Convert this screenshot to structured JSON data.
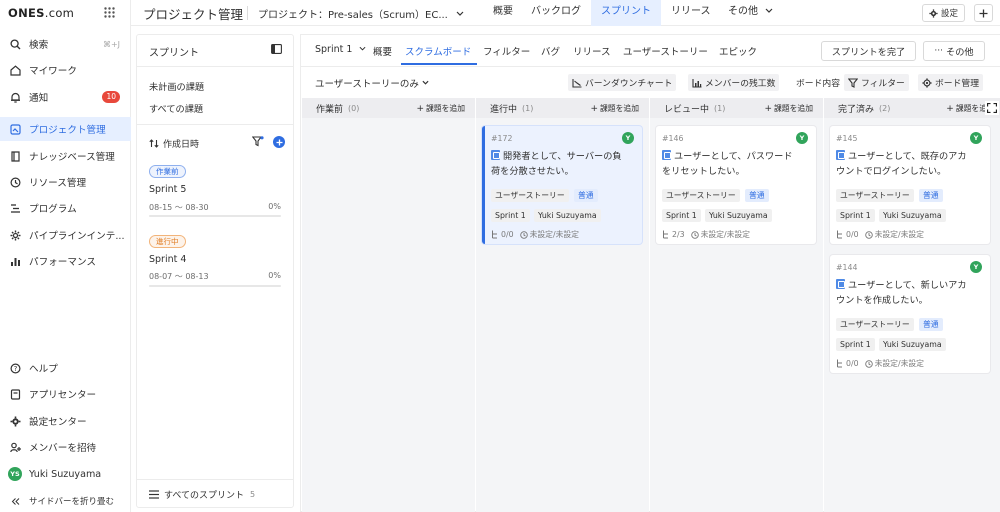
{
  "logo": {
    "text": "ONES",
    "suffix": ".com"
  },
  "nav": {
    "search": {
      "label": "検索",
      "shortcut": "⌘+J"
    },
    "mywork": "マイワーク",
    "notify": {
      "label": "通知",
      "count": "10"
    },
    "project": "プロジェクト管理",
    "wiki": "ナレッジベース管理",
    "resource": "リソース管理",
    "program": "プログラム",
    "pipeline": "パイプラインインテ...",
    "performance": "パフォーマンス",
    "help": "ヘルプ",
    "appcenter": "アプリセンター",
    "settings": "設定センター",
    "invite": "メンバーを招待",
    "user": {
      "name": "Yuki Suzuyama",
      "initials": "YS"
    },
    "collapse": "サイドバーを折り畳む"
  },
  "topbar": {
    "title": "プロジェクト管理",
    "project": "プロジェクト：Pre-sales（Scrum）EC...",
    "tabs": [
      "概要",
      "バックログ",
      "スプリント",
      "リリース",
      "その他"
    ],
    "settings": "設定"
  },
  "sprint_panel": {
    "title": "スプリント",
    "links": [
      "未計画の課題",
      "すべての課題"
    ],
    "sort": "作成日時",
    "sprints": [
      {
        "status": "作業前",
        "name": "Sprint 5",
        "dates": "08-15 〜 08-30",
        "percent": "0%",
        "progress": 0
      },
      {
        "status": "進行中",
        "name": "Sprint 4",
        "dates": "08-07 〜 08-13",
        "percent": "0%",
        "progress": 0
      }
    ],
    "footer": {
      "label": "すべてのスプリント",
      "count": "5"
    }
  },
  "board": {
    "sprint_select": "Sprint 1",
    "tabs": [
      "概要",
      "スクラムボード",
      "フィルター",
      "バグ",
      "リリース",
      "ユーザーストーリー",
      "エピック"
    ],
    "complete_button": "スプリントを完了",
    "more_button": "その他",
    "filter_select": "ユーザーストーリーのみ",
    "tools": {
      "burndown": "バーンダウンチャート",
      "remaining": "メンバーの残工数",
      "content": "ボード内容",
      "filter": "フィルター",
      "manage": "ボード管理"
    },
    "add_label": "課題を追加",
    "add_label_last": "課題を追",
    "columns": [
      {
        "name": "作業前",
        "count": "(0)",
        "cards": []
      },
      {
        "name": "進行中",
        "count": "(1)",
        "cards": [
          {
            "key": "#172",
            "line1": "開発者として、サーバーの負",
            "line2": "荷を分散させたい。",
            "type": "ユーザーストーリー",
            "priority": "普通",
            "sprint": "Sprint 1",
            "assignee": "Yuki Suzuyama",
            "subtasks": "0/0",
            "time": "未設定/未設定",
            "avatar": "Y"
          }
        ]
      },
      {
        "name": "レビュー中",
        "count": "(1)",
        "cards": [
          {
            "key": "#146",
            "line1": "ユーザーとして、パスワード",
            "line2": "をリセットしたい。",
            "type": "ユーザーストーリー",
            "priority": "普通",
            "sprint": "Sprint 1",
            "assignee": "Yuki Suzuyama",
            "subtasks": "2/3",
            "time": "未設定/未設定",
            "avatar": "Y"
          }
        ]
      },
      {
        "name": "完了済み",
        "count": "(2)",
        "cards": [
          {
            "key": "#145",
            "line1": "ユーザーとして、既存のアカ",
            "line2": "ウントでログインしたい。",
            "type": "ユーザーストーリー",
            "priority": "普通",
            "sprint": "Sprint 1",
            "assignee": "Yuki Suzuyama",
            "subtasks": "0/0",
            "time": "未設定/未設定",
            "avatar": "Y"
          },
          {
            "key": "#144",
            "line1": "ユーザーとして、新しいアカ",
            "line2": "ウントを作成したい。",
            "type": "ユーザーストーリー",
            "priority": "普通",
            "sprint": "Sprint 1",
            "assignee": "Yuki Suzuyama",
            "subtasks": "0/0",
            "time": "未設定/未設定",
            "avatar": "Y"
          }
        ]
      }
    ]
  }
}
